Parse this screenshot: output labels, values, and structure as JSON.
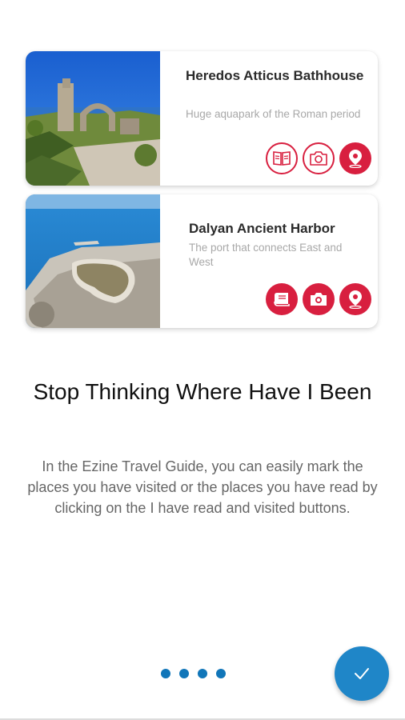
{
  "cards": [
    {
      "title": "Heredos Atticus Bathhouse",
      "subtitle": "Huge aquapark of the Roman period",
      "actions": [
        "book-icon",
        "camera-icon",
        "location-pin-icon"
      ],
      "action_style": "outline-except-location"
    },
    {
      "title": "Dalyan Ancient Harbor",
      "subtitle": "The port that connects East and West",
      "actions": [
        "book-icon",
        "camera-icon",
        "location-pin-icon"
      ],
      "action_style": "filled"
    }
  ],
  "onboarding": {
    "heading": "Stop Thinking Where Have I Been",
    "description": "In the Ezine Travel Guide, you can easily mark the places you have visited or the places you have read by clicking on the I have read and visited buttons."
  },
  "pager": {
    "total": 4
  },
  "colors": {
    "accent_red": "#d81f3f",
    "accent_blue": "#1f86c8",
    "dot_blue": "#1176b9"
  },
  "fab": {
    "icon": "checkmark-icon"
  }
}
